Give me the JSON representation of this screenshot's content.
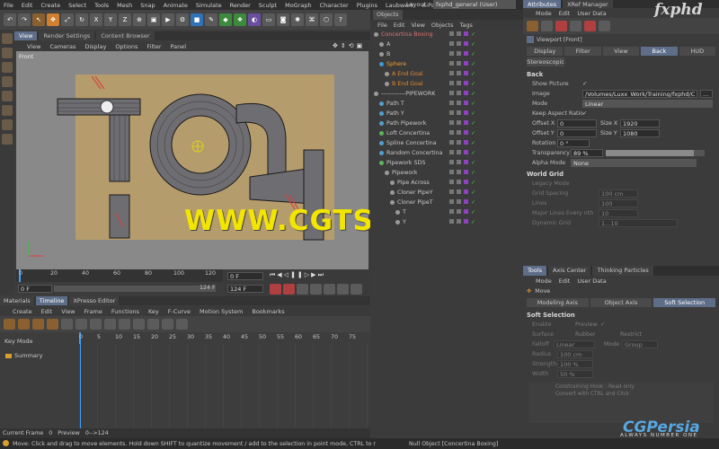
{
  "menubar": [
    "File",
    "Edit",
    "Create",
    "Select",
    "Tools",
    "Mesh",
    "Snap",
    "Animate",
    "Simulate",
    "Render",
    "Sculpt",
    "MoGraph",
    "Character",
    "Plugins",
    "Laubwerk",
    "X-Partic"
  ],
  "layout_label": "Layout:",
  "layout_value": "fxphd_general (User)",
  "viewport": {
    "tabs": [
      "View",
      "Render Settings",
      "Content Browser"
    ],
    "menu": [
      "View",
      "Cameras",
      "Display",
      "Options",
      "Filter",
      "Panel"
    ],
    "label": "Front"
  },
  "timeline": {
    "ticks": [
      "0",
      "20",
      "40",
      "60",
      "80",
      "100",
      "120"
    ],
    "current_frame": "0 F",
    "start_frame": "0 F",
    "end_field": "124 F",
    "end_field_small": "124 F"
  },
  "lower_tabs": [
    "Materials",
    "Timeline",
    "XPresso Editor"
  ],
  "lower_menu": [
    "Create",
    "Edit",
    "View",
    "Frame",
    "Functions",
    "Key",
    "F-Curve",
    "Motion System",
    "Bookmarks"
  ],
  "dopesheet": {
    "mode_label": "Key Mode",
    "ticks": [
      "0",
      "5",
      "10",
      "15",
      "20",
      "25",
      "30",
      "35",
      "40",
      "45",
      "50",
      "55",
      "60",
      "65",
      "70",
      "75"
    ],
    "summary_label": "Summary"
  },
  "status_frame": {
    "label": "Current Frame",
    "value": "0",
    "preview_label": "Preview",
    "preview_value": "0-->124"
  },
  "statusbar": "Move: Click and drag to move elements. Hold down SHIFT to quantize movement / add to the selection in point mode, CTRL to r",
  "statusbar_right": "Null Object [Concertina Boxing]",
  "objects": {
    "tab": "Objects",
    "menu": [
      "File",
      "Edit",
      "View",
      "Objects",
      "Tags"
    ],
    "rows": [
      {
        "name": "Concertina Boxing",
        "indent": 0,
        "color": "#e07070",
        "dot": "#9a9a9a"
      },
      {
        "name": "A",
        "indent": 1,
        "color": "#c8c8c8",
        "dot": "#9a9a9a"
      },
      {
        "name": "B",
        "indent": 1,
        "color": "#c8c8c8",
        "dot": "#9a9a9a"
      },
      {
        "name": "Sphere",
        "indent": 1,
        "color": "#f0a030",
        "dot": "#3a9ad8"
      },
      {
        "name": "A End Goal",
        "indent": 2,
        "color": "#e08a30",
        "dot": "#9a9a9a"
      },
      {
        "name": "B End Goal",
        "indent": 2,
        "color": "#e08a30",
        "dot": "#9a9a9a"
      },
      {
        "name": "------------PIPEWORK",
        "indent": 0,
        "color": "#c8c8c8",
        "dot": "#9a9a9a"
      },
      {
        "name": "Path T",
        "indent": 1,
        "color": "#c8c8c8",
        "dot": "#4fa0d0"
      },
      {
        "name": "Path Y",
        "indent": 1,
        "color": "#c8c8c8",
        "dot": "#4fa0d0"
      },
      {
        "name": "Path Pipework",
        "indent": 1,
        "color": "#c8c8c8",
        "dot": "#4fa0d0"
      },
      {
        "name": "Loft Concertina",
        "indent": 1,
        "color": "#c8c8c8",
        "dot": "#5ab85a"
      },
      {
        "name": "Spline Concertina",
        "indent": 1,
        "color": "#c8c8c8",
        "dot": "#4fa0d0"
      },
      {
        "name": "Random Concertina",
        "indent": 1,
        "color": "#c8c8c8",
        "dot": "#4fa0d0"
      },
      {
        "name": "Pipework SDS",
        "indent": 1,
        "color": "#c8c8c8",
        "dot": "#5ab85a"
      },
      {
        "name": "Pipework",
        "indent": 2,
        "color": "#c8c8c8",
        "dot": "#9a9a9a"
      },
      {
        "name": "Pipe Across",
        "indent": 3,
        "color": "#c8c8c8",
        "dot": "#9a9a9a"
      },
      {
        "name": "Cloner PipeY",
        "indent": 3,
        "color": "#c8c8c8",
        "dot": "#9a9a9a"
      },
      {
        "name": "Cloner PipeT",
        "indent": 3,
        "color": "#c8c8c8",
        "dot": "#9a9a9a"
      },
      {
        "name": "T",
        "indent": 4,
        "color": "#c8c8c8",
        "dot": "#9a9a9a"
      },
      {
        "name": "Y",
        "indent": 4,
        "color": "#c8c8c8",
        "dot": "#9a9a9a"
      }
    ]
  },
  "attributes": {
    "tabs": [
      "Attributes",
      "XRef Manager"
    ],
    "menu": [
      "Mode",
      "Edit",
      "User Data"
    ],
    "title": "Viewport [Front]",
    "subtabs": [
      "Display",
      "Filter",
      "View",
      "Back",
      "HUD"
    ],
    "subtab2": "Stereoscopic",
    "back_section": "Back",
    "show_picture": "Show Picture",
    "image_label": "Image",
    "image_value": "/Volumes/Luxx_Work/Training/fxphd/C",
    "mode_label": "Mode",
    "mode_value": "Linear",
    "keep_aspect": "Keep Aspect Ratio",
    "offset_x_label": "Offset X",
    "offset_x": "0",
    "size_x_label": "Size X",
    "size_x": "1920",
    "offset_y_label": "Offset Y",
    "offset_y": "0",
    "size_y_label": "Size Y",
    "size_y": "1080",
    "rotation_label": "Rotation",
    "rotation": "0 °",
    "transparency_label": "Transparency",
    "transparency": "89 %",
    "transparency_level": 0.89,
    "alpha_label": "Alpha Mode",
    "alpha_value": "None",
    "world_grid": "World Grid",
    "legacy_mode": "Legacy Mode",
    "grid_spacing_label": "Grid Spacing",
    "grid_spacing": "100 cm",
    "lines_label": "Lines",
    "lines": "100",
    "major_label": "Major Lines Every nth",
    "major": "10",
    "dynamic_label": "Dynamic Grid",
    "dynamic": "1...10"
  },
  "tools": {
    "tabs": [
      "Tools",
      "Axis Center",
      "Thinking Particles"
    ],
    "menu": [
      "Mode",
      "Edit",
      "User Data"
    ],
    "title": "Move",
    "subtabs": [
      "Modeling Axis",
      "Object Axis",
      "Soft Selection"
    ],
    "section": "Soft Selection",
    "enable": "Enable",
    "preview": "Preview",
    "surface": "Surface",
    "rubber": "Rubber",
    "restrict": "Restrict",
    "falloff_label": "Falloff",
    "falloff": "Linear",
    "mode_label": "Mode",
    "mode": "Group",
    "radius_label": "Radius",
    "radius": "100 cm",
    "strength_label": "Strength",
    "strength": "100 %",
    "width_label": "Width",
    "width": "50 %",
    "graph_text1": "Constraining Hook : Read only",
    "graph_text2": "Convert with CTRL and Click"
  },
  "watermarks": {
    "main": "WWW.CGTSJ.COM",
    "fxphd": "fxphd",
    "cgp": "CGPersia",
    "cgp_sub": "ALWAYS NUMBER ONE"
  },
  "colors": {
    "accent_tab": "#5e6e88",
    "watermark": "#f2e600",
    "playhead": "#3fa0ff"
  }
}
